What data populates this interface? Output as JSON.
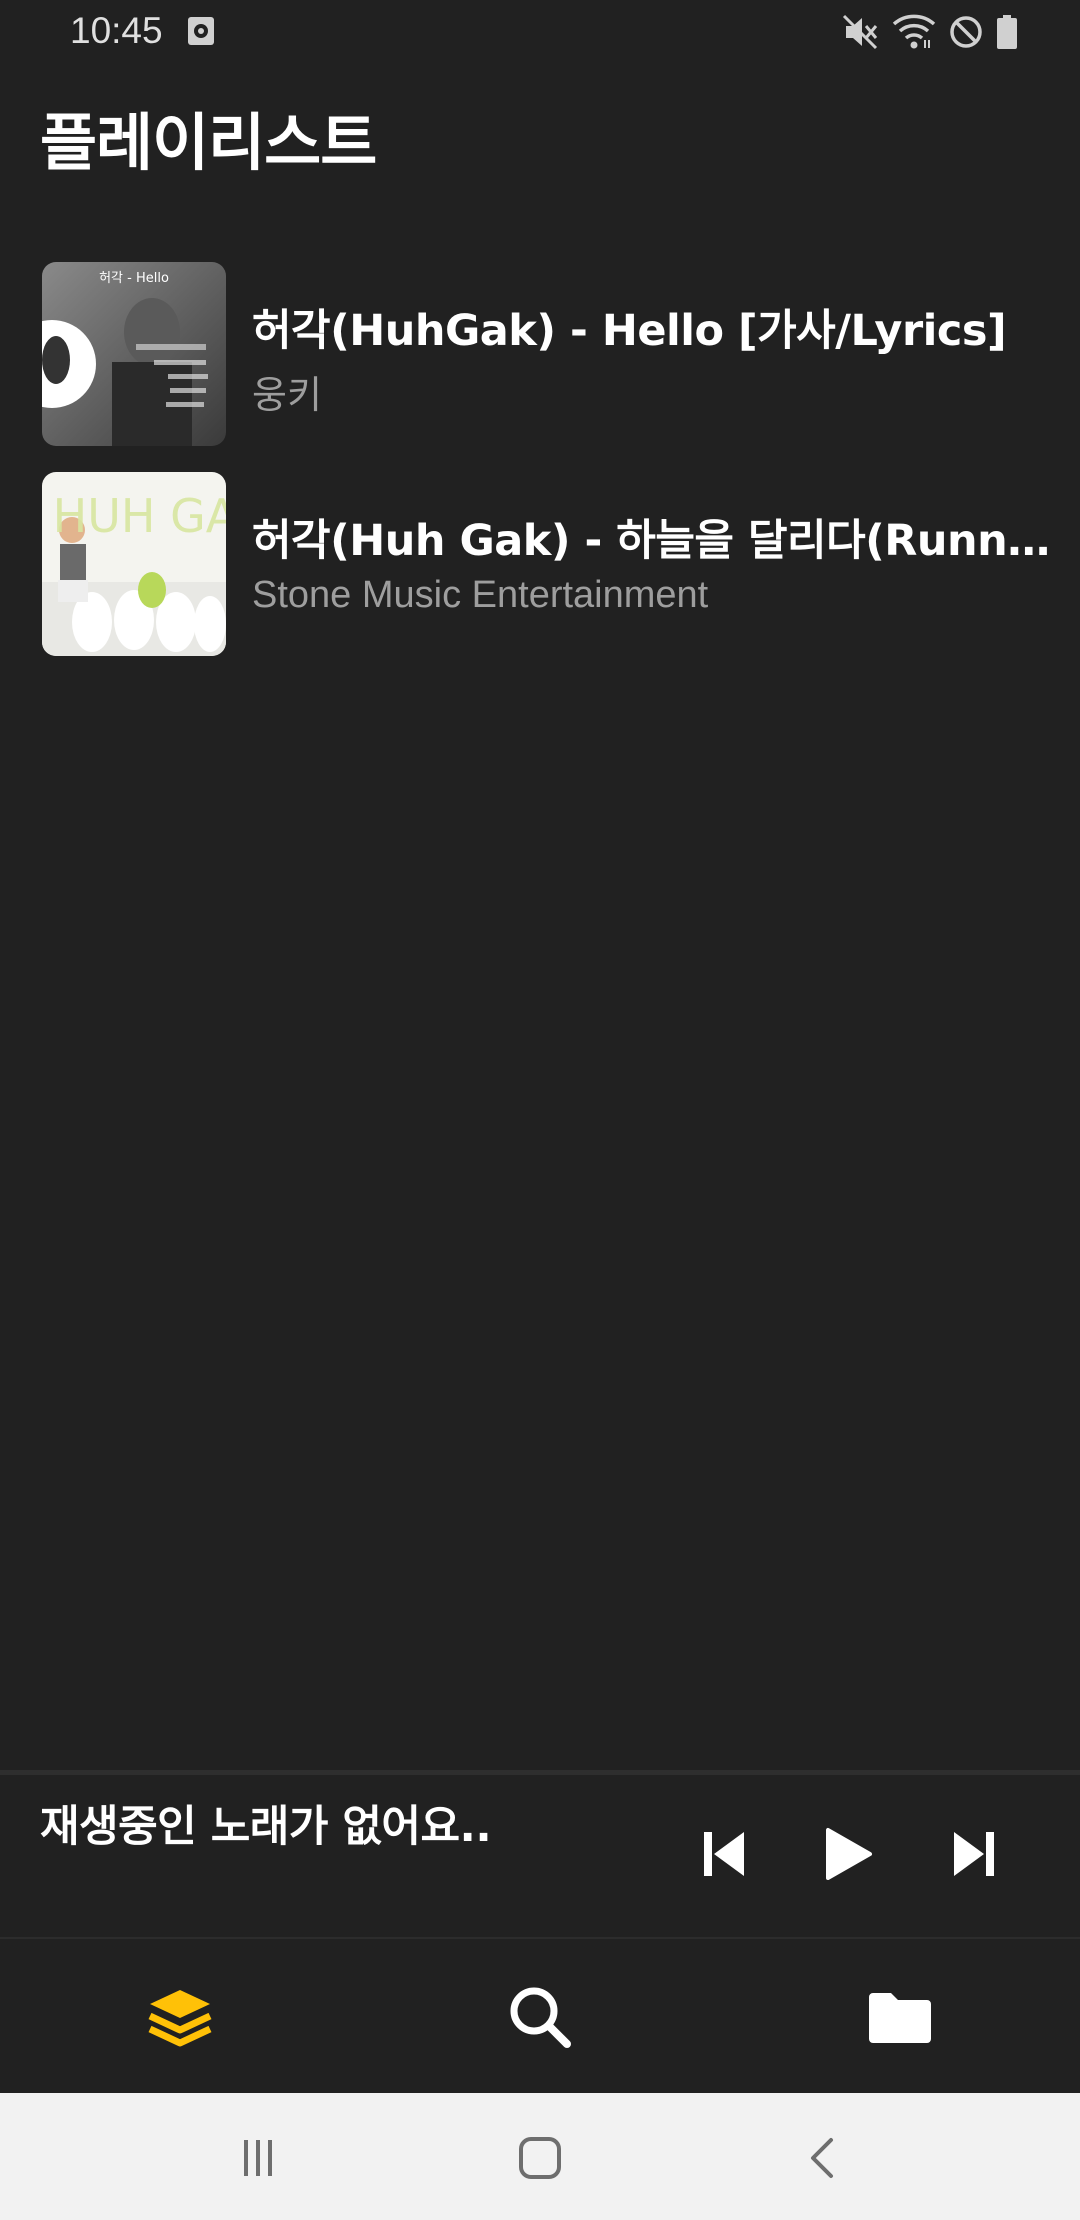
{
  "status_bar": {
    "time": "10:45",
    "icons": [
      "media-icon",
      "mute-icon",
      "wifi-icon",
      "blocked-icon",
      "battery-icon"
    ]
  },
  "page": {
    "title": "플레이리스트"
  },
  "playlist": [
    {
      "title": "허각(HuhGak) - Hello [가사/Lyrics]",
      "channel": "웅키",
      "thumb_caption": "허각 - Hello"
    },
    {
      "title": "허각(Huh Gak) - 하늘을 달리다(Running In The Sky)",
      "channel": "Stone Music Entertainment",
      "thumb_caption": "HUH GAK"
    }
  ],
  "now_playing": {
    "text": "재생중인 노래가 없어요..",
    "controls": [
      "previous-icon",
      "play-icon",
      "next-icon"
    ]
  },
  "bottom_nav": {
    "items": [
      "playlist-layers-icon",
      "search-icon",
      "folder-icon"
    ],
    "active_color": "#FFC107"
  },
  "system_nav": {
    "items": [
      "recents-icon",
      "home-icon",
      "back-icon"
    ]
  },
  "colors": {
    "background": "#212121",
    "accent": "#FFC107",
    "secondary_text": "#9E9E9E"
  }
}
